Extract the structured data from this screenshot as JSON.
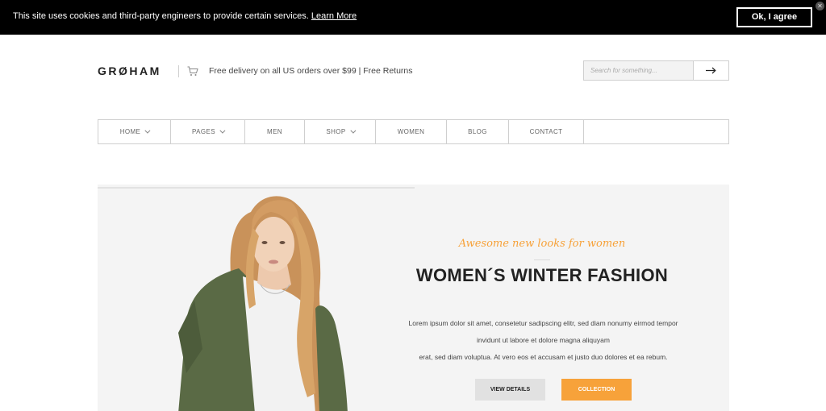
{
  "cookie": {
    "message": "This site uses cookies and third-party engineers to provide certain services.",
    "link": "Learn More",
    "agree": "Ok, I agree",
    "close_icon": "close-icon"
  },
  "header": {
    "logo": "GRØHAM",
    "delivery": "Free delivery on all US orders over $99 | Free Returns",
    "cart_icon": "cart-icon"
  },
  "search": {
    "placeholder": "Search for something...",
    "button_icon": "arrow-right-icon"
  },
  "nav": {
    "items": [
      {
        "label": "HOME",
        "dropdown": true
      },
      {
        "label": "PAGES",
        "dropdown": true
      },
      {
        "label": "MEN",
        "dropdown": false
      },
      {
        "label": "SHOP",
        "dropdown": true
      },
      {
        "label": "WOMEN",
        "dropdown": false
      },
      {
        "label": "BLOG",
        "dropdown": false
      },
      {
        "label": "CONTACT",
        "dropdown": false
      }
    ]
  },
  "hero": {
    "tagline": "Awesome new looks for women",
    "title": "WOMEN´S WINTER FASHION",
    "text_line1": "Lorem ipsum dolor sit amet, consetetur sadipscing elitr, sed diam nonumy eirmod tempor",
    "text_line2": "invidunt ut labore et dolore magna aliquyam",
    "text_line3": "erat, sed diam voluptua. At vero eos et accusam et justo duo dolores et ea rebum.",
    "details_button": "VIEW DETAILS",
    "collection_button": "COLLECTION"
  },
  "colors": {
    "accent": "#f7a23a",
    "cookie_bg": "#000000",
    "hero_bg": "#f4f4f4",
    "jacket": "#5a6a45",
    "hair": "#c9925a"
  }
}
